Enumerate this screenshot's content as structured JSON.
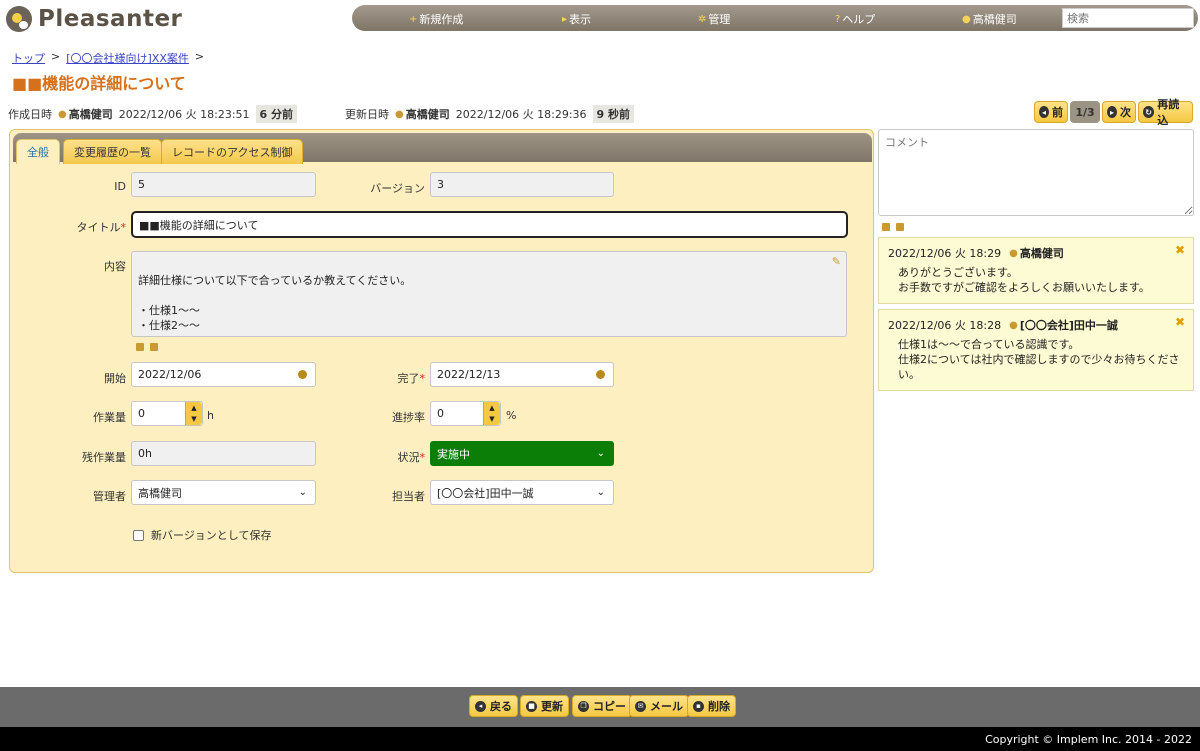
{
  "app": {
    "name": "Pleasanter"
  },
  "nav": {
    "new": "新規作成",
    "view": "表示",
    "admin": "管理",
    "help": "ヘルプ",
    "user": "高橋健司",
    "search_placeholder": "検索"
  },
  "breadcrumb": {
    "top": "トップ",
    "sep": ">",
    "project": "[〇〇会社様向け]XX案件"
  },
  "page_title": "■■機能の詳細について",
  "meta": {
    "created_label": "作成日時",
    "created_user": "高橋健司",
    "created_at": "2022/12/06 火 18:23:51",
    "created_ago": "6 分前",
    "updated_label": "更新日時",
    "updated_user": "高橋健司",
    "updated_at": "2022/12/06 火 18:29:36",
    "updated_ago": "9 秒前"
  },
  "pager": {
    "prev": "前",
    "count": "1/3",
    "next": "次",
    "reload": "再読込"
  },
  "tabs": [
    "全般",
    "変更履歴の一覧",
    "レコードのアクセス制御"
  ],
  "form": {
    "id_label": "ID",
    "id_value": "5",
    "version_label": "バージョン",
    "version_value": "3",
    "title_label": "タイトル",
    "title_value": "■■機能の詳細について",
    "content_label": "内容",
    "content_value": "詳細仕様について以下で合っているか教えてください。\n\n・仕様1〜〜\n・仕様2〜〜",
    "start_label": "開始",
    "start_value": "2022/12/06",
    "end_label": "完了",
    "end_value": "2022/12/13",
    "work_label": "作業量",
    "work_value": "0",
    "work_unit": "h",
    "progress_label": "進捗率",
    "progress_value": "0",
    "progress_unit": "%",
    "remaining_label": "残作業量",
    "remaining_value": "0h",
    "status_label": "状況",
    "status_value": "実施中",
    "manager_label": "管理者",
    "manager_value": "高橋健司",
    "owner_label": "担当者",
    "owner_value": "[〇〇会社]田中一誠",
    "new_version_label": "新バージョンとして保存",
    "required_mark": "*"
  },
  "comments": {
    "placeholder": "コメント",
    "items": [
      {
        "datetime": "2022/12/06 火 18:29",
        "user": "高橋健司",
        "body": "ありがとうございます。\nお手数ですがご確認をよろしくお願いいたします。"
      },
      {
        "datetime": "2022/12/06 火 18:28",
        "user": "[〇〇会社]田中一誠",
        "body": "仕様1は〜〜で合っている認識です。\n仕様2については社内で確認しますので少々お待ちくださ\nい。"
      }
    ]
  },
  "actions": {
    "back": "戻る",
    "update": "更新",
    "copy": "コピー",
    "mail": "メール",
    "delete": "削除"
  },
  "footer": {
    "copyright": "Copyright © Implem Inc. 2014 - 2022"
  },
  "colors": {
    "accent": "#f4c842",
    "title": "#d6711b",
    "status": "#0a7e07",
    "panel": "#fdefc0"
  }
}
